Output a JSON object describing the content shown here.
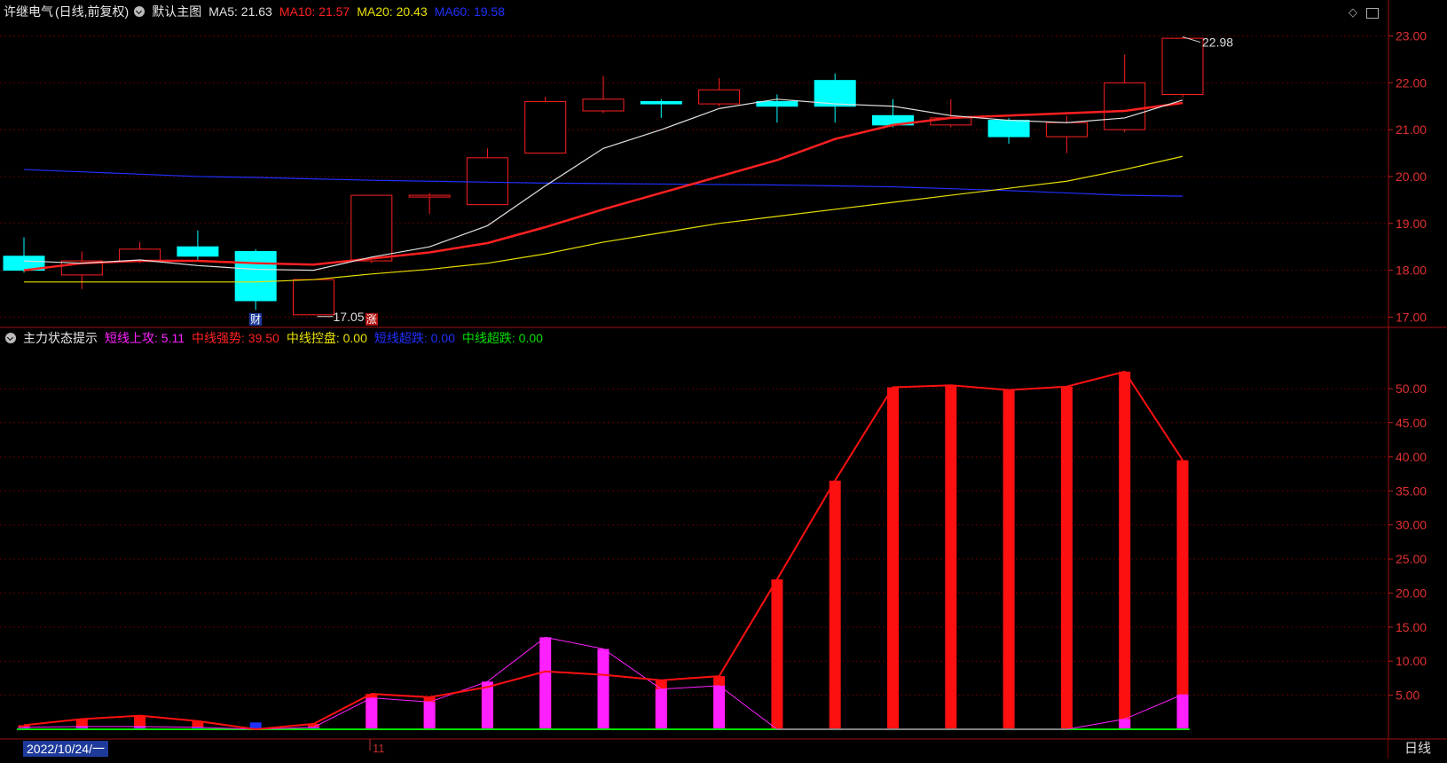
{
  "main_chart": {
    "stock_name": "许继电气",
    "mode": "(日线,前复权)",
    "template": "默认主图",
    "ma": [
      {
        "label": "MA5:",
        "value": "21.63",
        "color": "#e0e0e0"
      },
      {
        "label": "MA10:",
        "value": "21.57",
        "color": "#ff2020"
      },
      {
        "label": "MA20:",
        "value": "20.43",
        "color": "#e8e000"
      },
      {
        "label": "MA60:",
        "value": "19.58",
        "color": "#2030ff"
      }
    ],
    "y_ticks": [
      "23.00",
      "22.00",
      "21.00",
      "20.00",
      "19.00",
      "18.00",
      "17.00"
    ],
    "y_tick_values": [
      23,
      22,
      21,
      20,
      19,
      18,
      17
    ],
    "ylim": [
      16.8,
      23.35
    ],
    "high_label": "22.98",
    "low_label": "17.05",
    "flags": [
      {
        "text": "财",
        "bar": 4
      },
      {
        "text": "涨",
        "bar": 6
      }
    ],
    "candles": [
      {
        "o": 18.0,
        "h": 18.7,
        "l": 17.95,
        "c": 18.3,
        "color": "#00ffff"
      },
      {
        "o": 17.9,
        "h": 18.4,
        "l": 17.6,
        "c": 18.2,
        "color": "#ff2020"
      },
      {
        "o": 18.2,
        "h": 18.6,
        "l": 18.15,
        "c": 18.45,
        "color": "#ff2020"
      },
      {
        "o": 18.5,
        "h": 18.85,
        "l": 18.2,
        "c": 18.3,
        "color": "#00ffff"
      },
      {
        "o": 18.4,
        "h": 18.45,
        "l": 17.15,
        "c": 17.35,
        "color": "#00ffff"
      },
      {
        "o": 17.05,
        "h": 17.8,
        "l": 17.05,
        "c": 17.8,
        "color": "#ff2020"
      },
      {
        "o": 18.2,
        "h": 19.6,
        "l": 18.15,
        "c": 19.6,
        "color": "#ff2020"
      },
      {
        "o": 19.6,
        "h": 19.65,
        "l": 19.2,
        "c": 19.6,
        "color": "#ff2020"
      },
      {
        "o": 19.4,
        "h": 20.6,
        "l": 19.4,
        "c": 20.4,
        "color": "#ff2020"
      },
      {
        "o": 20.5,
        "h": 21.7,
        "l": 20.5,
        "c": 21.6,
        "color": "#ff2020"
      },
      {
        "o": 21.4,
        "h": 22.15,
        "l": 21.35,
        "c": 21.65,
        "color": "#ff2020"
      },
      {
        "o": 21.6,
        "h": 21.65,
        "l": 21.25,
        "c": 21.55,
        "color": "#00ffff"
      },
      {
        "o": 21.55,
        "h": 22.1,
        "l": 21.5,
        "c": 21.85,
        "color": "#ff2020"
      },
      {
        "o": 21.6,
        "h": 21.75,
        "l": 21.15,
        "c": 21.5,
        "color": "#00ffff"
      },
      {
        "o": 22.05,
        "h": 22.2,
        "l": 21.15,
        "c": 21.5,
        "color": "#00ffff"
      },
      {
        "o": 21.3,
        "h": 21.65,
        "l": 21.05,
        "c": 21.1,
        "color": "#00ffff"
      },
      {
        "o": 21.1,
        "h": 21.65,
        "l": 21.05,
        "c": 21.25,
        "color": "#ff2020"
      },
      {
        "o": 21.2,
        "h": 21.25,
        "l": 20.7,
        "c": 20.85,
        "color": "#00ffff"
      },
      {
        "o": 20.85,
        "h": 21.3,
        "l": 20.5,
        "c": 21.15,
        "color": "#ff2020"
      },
      {
        "o": 21.0,
        "h": 22.6,
        "l": 20.95,
        "c": 22.0,
        "color": "#ff2020"
      },
      {
        "o": 21.75,
        "h": 22.98,
        "l": 21.7,
        "c": 22.95,
        "color": "#ff2020"
      }
    ],
    "ma5": [
      18.2,
      18.15,
      18.22,
      18.1,
      18.02,
      18.0,
      18.28,
      18.5,
      18.95,
      19.8,
      20.6,
      21.0,
      21.45,
      21.65,
      21.55,
      21.5,
      21.3,
      21.2,
      21.15,
      21.25,
      21.63
    ],
    "ma10": [
      18.0,
      18.15,
      18.2,
      18.2,
      18.15,
      18.12,
      18.25,
      18.38,
      18.58,
      18.92,
      19.3,
      19.65,
      20.0,
      20.35,
      20.8,
      21.1,
      21.25,
      21.3,
      21.35,
      21.4,
      21.57
    ],
    "ma20": [
      17.75,
      17.75,
      17.75,
      17.75,
      17.75,
      17.8,
      17.92,
      18.02,
      18.15,
      18.35,
      18.6,
      18.8,
      19.0,
      19.15,
      19.3,
      19.45,
      19.6,
      19.75,
      19.9,
      20.15,
      20.43
    ],
    "ma60": [
      20.15,
      20.1,
      20.05,
      20.0,
      19.98,
      19.95,
      19.92,
      19.9,
      19.88,
      19.86,
      19.85,
      19.84,
      19.83,
      19.82,
      19.8,
      19.78,
      19.74,
      19.7,
      19.65,
      19.6,
      19.58
    ]
  },
  "sub_chart": {
    "title": "主力状态提示",
    "indicators": [
      {
        "label": "短线上攻:",
        "value": "5.11",
        "color": "#ff20ff"
      },
      {
        "label": "中线强势:",
        "value": "39.50",
        "color": "#ff2020"
      },
      {
        "label": "中线控盘:",
        "value": "0.00",
        "color": "#e8e000"
      },
      {
        "label": "短线超跌:",
        "value": "0.00",
        "color": "#2030ff"
      },
      {
        "label": "中线超跌:",
        "value": "0.00",
        "color": "#00e000"
      }
    ],
    "y_ticks": [
      "50.00",
      "45.00",
      "40.00",
      "35.00",
      "30.00",
      "25.00",
      "20.00",
      "15.00",
      "10.00",
      "5.00"
    ],
    "y_tick_values": [
      50,
      45,
      40,
      35,
      30,
      25,
      20,
      15,
      10,
      5
    ],
    "ylim": [
      0,
      56
    ],
    "mid_strong": [
      0.6,
      1.5,
      2.0,
      1.2,
      0.0,
      0.8,
      5.2,
      4.7,
      6.2,
      8.5,
      8.0,
      7.2,
      7.8,
      22.0,
      36.5,
      50.2,
      50.5,
      49.8,
      50.3,
      52.5,
      39.5
    ],
    "short_attack": [
      0.3,
      0.4,
      0.4,
      0.3,
      0.0,
      0.3,
      4.6,
      4.0,
      7.0,
      13.5,
      11.8,
      5.9,
      6.4,
      0.0,
      0.0,
      0.0,
      0.0,
      0.0,
      0.0,
      1.5,
      5.11
    ],
    "short_oversold": [
      0.2,
      0.2,
      0.2,
      0.3,
      1.0,
      0.2,
      0.0,
      0.0,
      0.0,
      0.0,
      0.0,
      0.0,
      0.0,
      0.0,
      0.0,
      0.0,
      0.0,
      0.0,
      0.0,
      0.0,
      0.0
    ]
  },
  "bottom": {
    "date_label": "2022/10/24/一",
    "month_tick": "11",
    "period_tab": "日线"
  }
}
